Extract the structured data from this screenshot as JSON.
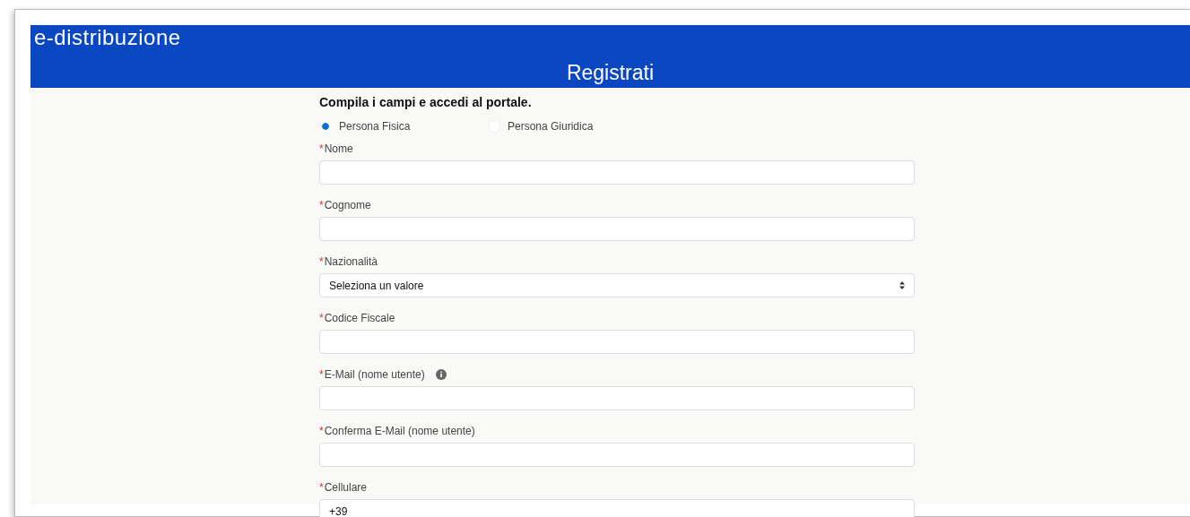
{
  "header": {
    "logo": "e-distribuzione",
    "title": "Registrati"
  },
  "form": {
    "intro": "Compila i campi e accedi al portale.",
    "person_types": [
      {
        "label": "Persona Fisica",
        "selected": true
      },
      {
        "label": "Persona Giuridica",
        "selected": false
      }
    ],
    "fields": [
      {
        "kind": "text",
        "required_mark": "*",
        "label": "Nome",
        "info": false
      },
      {
        "kind": "text",
        "required_mark": "*",
        "label": "Cognome",
        "info": false
      },
      {
        "kind": "select",
        "required_mark": "*",
        "label": "Nazionalità",
        "value": "Seleziona un valore",
        "info": false
      },
      {
        "kind": "text",
        "required_mark": "*",
        "label": "Codice Fiscale",
        "info": false
      },
      {
        "kind": "text",
        "required_mark": "*",
        "label": "E-Mail (nome utente)",
        "info": true
      },
      {
        "kind": "text",
        "required_mark": "*",
        "label": "Conferma E-Mail (nome utente)",
        "info": false
      },
      {
        "kind": "text",
        "required_mark": "*",
        "label": "Cellulare",
        "value": "+39",
        "info": false
      }
    ]
  }
}
